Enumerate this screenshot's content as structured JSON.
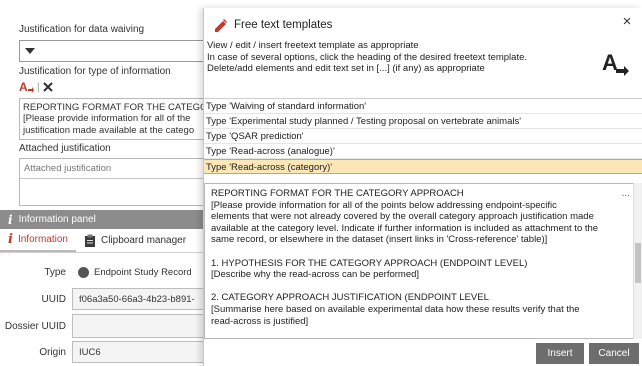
{
  "background": {
    "justification_waiving_label": "Justification for data waiving",
    "justification_type_label": "Justification for type of information",
    "textbox_lines": [
      "REPORTING FORMAT FOR THE CATEGO",
      "[Please provide information for all of the",
      "justification made available at the catego"
    ],
    "attached_justification_label": "Attached justification",
    "attached_justification_placeholder": "Attached justification"
  },
  "info_panel": {
    "title": "Information panel",
    "tabs": [
      "Information",
      "Clipboard manager"
    ],
    "rows": [
      {
        "label": "Type",
        "value": "Endpoint Study Record"
      },
      {
        "label": "UUID",
        "value": "f06a3a50-66a3-4b23-b891-"
      },
      {
        "label": "Dossier UUID",
        "value": ""
      },
      {
        "label": "Origin",
        "value": "IUC6"
      }
    ]
  },
  "dialog": {
    "title": "Free text templates",
    "close_label": "×",
    "instructions": [
      "View / edit / insert freetext template as appropriate",
      "In case of several options, click the heading of the desired freetext template.",
      "Delete/add elements and edit text set in [...] (if any) as appropriate"
    ],
    "templates": [
      "Type 'Waiving of standard information'",
      "Type 'Experimental study planned / Testing proposal on vertebrate animals'",
      "Type 'QSAR prediction'",
      "Type 'Read-across (analogue)'",
      "Type 'Read-across (category)'"
    ],
    "selected_template_index": 4,
    "more_label": "...",
    "template_text": [
      "REPORTING FORMAT FOR THE CATEGORY APPROACH",
      "[Please provide information for all of the points below addressing endpoint-specific",
      "elements that were not already covered by the overall category approach justification made",
      "available at the category level. Indicate if further information is included as attachment to the",
      "same record, or elsewhere in the dataset (insert links in 'Cross-reference' table)]",
      "",
      "1. HYPOTHESIS FOR THE CATEGORY APPROACH (ENDPOINT LEVEL)",
      "[Describe why the read-across can be performed]",
      "",
      "2. CATEGORY APPROACH JUSTIFICATION (ENDPOINT LEVEL",
      "[Summarise here based on available experimental data how these results verify that the",
      "read-across is justified]"
    ],
    "insert_label": "Insert",
    "cancel_label": "Cancel"
  },
  "colors": {
    "selected_row_bg": "#fbe7b5",
    "button_bg": "#6d6d6d",
    "logo_red": "#c0392b",
    "info_header_bg": "#8c8c8c"
  },
  "icons": {
    "dialog": "free-text-template-icon",
    "logo": "iuclid-a-arrow-logo",
    "info": "info-icon",
    "clipboard": "clipboard-icon",
    "record_type": "record-type-circle-icon",
    "tool_a": "font-a-icon",
    "tool_x": "delete-x-icon"
  }
}
